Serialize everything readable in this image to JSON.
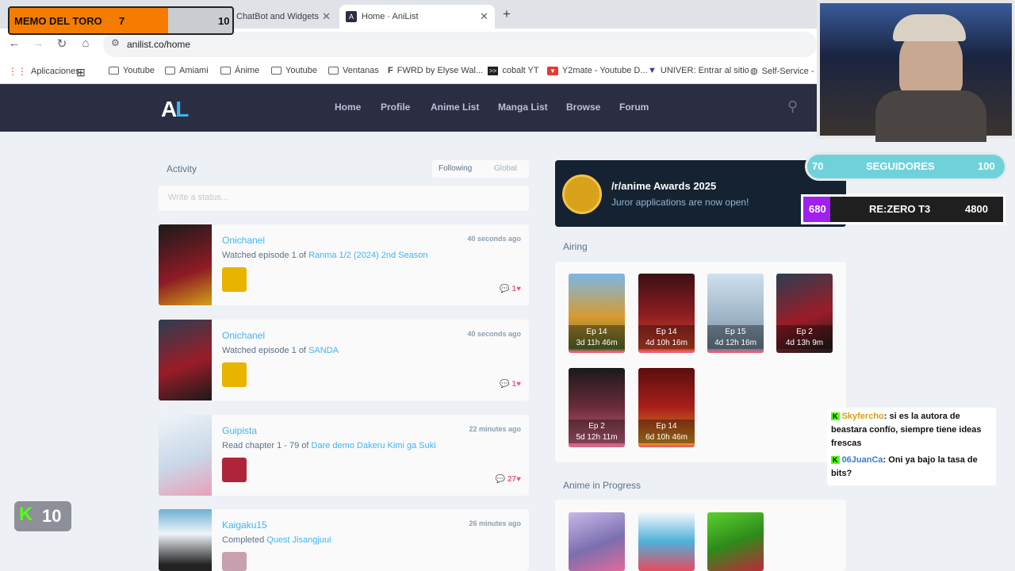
{
  "browser": {
    "tabs": [
      {
        "label": "ChatBot and Widgets"
      },
      {
        "label": "Home · AniList"
      }
    ],
    "new_tab": "+",
    "url": "anilist.co/home",
    "bookmarks": [
      {
        "label": "Aplicaciones"
      },
      {
        "label": "Youtube"
      },
      {
        "label": "Amiami"
      },
      {
        "label": "Ánime"
      },
      {
        "label": "Youtube"
      },
      {
        "label": "Ventanas"
      },
      {
        "label": "FWRD by Elyse Wal..."
      },
      {
        "label": "cobalt YT"
      },
      {
        "label": "Y2mate - Youtube D..."
      },
      {
        "label": "UNIVER: Entrar al sitio"
      },
      {
        "label": "Self-Service -"
      }
    ]
  },
  "site": {
    "logo": "AL",
    "nav": [
      "Home",
      "Profile",
      "Anime List",
      "Manga List",
      "Browse",
      "Forum"
    ]
  },
  "activity": {
    "title": "Activity",
    "filters": [
      "Following",
      "Global"
    ],
    "status_placeholder": "Write a status...",
    "items": [
      {
        "user": "Onichanel",
        "action": "Watched episode 1 of",
        "title": "Ranma 1/2 (2024) 2nd Season",
        "time": "40 seconds ago",
        "likes": "1",
        "cover": "#8e1b25",
        "avatar": "#e8b400"
      },
      {
        "user": "Onichanel",
        "action": "Watched episode 1 of",
        "title": "SANDA",
        "time": "40 seconds ago",
        "likes": "1",
        "cover": "#2c3e50",
        "avatar": "#e8b400"
      },
      {
        "user": "Guipista",
        "action": "Read chapter 1 - 79 of",
        "title": "Dare demo Dakeru Kimi ga Suki",
        "time": "22 minutes ago",
        "likes": "27",
        "cover": "#c9d8e8",
        "avatar": "#b0243a"
      },
      {
        "user": "Kaigaku15",
        "action": "Completed",
        "title": "Quest Jisangjuui",
        "time": "26 minutes ago",
        "likes": "",
        "cover": "#6db0d4",
        "avatar": "#c8a0b0"
      }
    ]
  },
  "banner": {
    "title": "/r/anime Awards 2025",
    "subtitle": "Juror applications are now open!"
  },
  "airing": {
    "title": "Airing",
    "items": [
      {
        "ep": "Ep 14",
        "time": "3d 11h 46m",
        "color": "#c78a3a"
      },
      {
        "ep": "Ep 14",
        "time": "4d 10h 16m",
        "color": "#8a1c22"
      },
      {
        "ep": "Ep 15",
        "time": "4d 12h 16m",
        "color": "#9fb6c8"
      },
      {
        "ep": "Ep 2",
        "time": "4d 13h 9m",
        "color": "#3a3f4a"
      },
      {
        "ep": "Ep 2",
        "time": "5d 12h 11m",
        "color": "#6b2b3a"
      },
      {
        "ep": "Ep 14",
        "time": "6d 10h 46m",
        "color": "#a8201a"
      }
    ]
  },
  "in_progress": {
    "title": "Anime in Progress",
    "colors": [
      "#7b6fb0",
      "#4fb0d8",
      "#5bd12e"
    ]
  },
  "overlays": {
    "memo_name": "MEMO DEL TORO",
    "memo_current": "7",
    "memo_goal": "10",
    "followers_current": "70",
    "followers_label": "SEGUIDORES",
    "followers_goal": "100",
    "rezero_current": "680",
    "rezero_label": "RE:ZERO T3",
    "rezero_goal": "4800",
    "k_badge": "10",
    "chat": [
      {
        "user": "Skyfercho",
        "text": ": si es la autora de beastara confío, siempre tiene ideas frescas"
      },
      {
        "user": "06JuanCa",
        "text": ": Oni ya bajo la tasa de bits?"
      }
    ]
  },
  "colors": {
    "nav_bg": "#2b2d42",
    "accent": "#3db4f2",
    "like": "#ec5f7b"
  }
}
